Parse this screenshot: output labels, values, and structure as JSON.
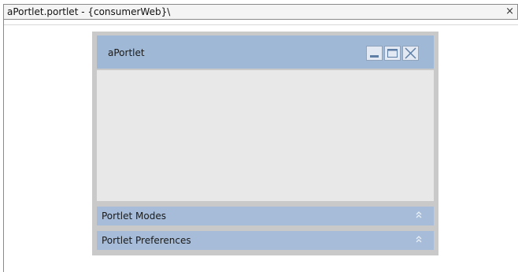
{
  "editor": {
    "tab_title": "aPortlet.portlet - {consumerWeb}\\",
    "close_glyph": "×"
  },
  "portlet": {
    "title": "aPortlet",
    "buttons": [
      {
        "name": "minimize-icon"
      },
      {
        "name": "maximize-icon"
      },
      {
        "name": "close-icon"
      }
    ],
    "sections": [
      {
        "label": "Portlet Modes",
        "icon": "chevron-double-up-icon"
      },
      {
        "label": "Portlet Preferences",
        "icon": "chevron-double-up-icon"
      }
    ]
  },
  "colors": {
    "header": "#9fb8d6",
    "section": "#a6bcd8",
    "frame": "#c9c9c9",
    "content": "#e8e8e8"
  }
}
